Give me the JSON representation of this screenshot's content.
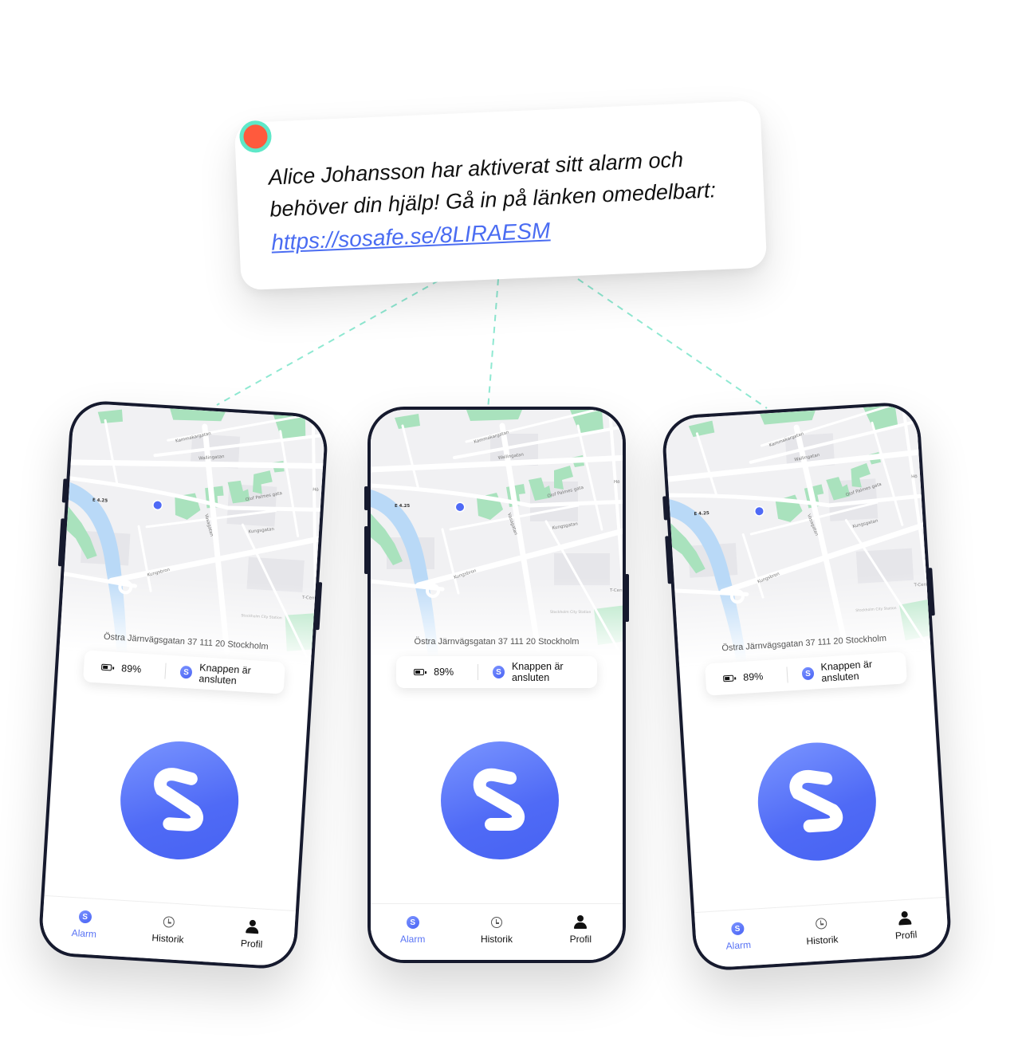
{
  "notification": {
    "line1": "Alice Johansson har aktiverat sitt alarm och",
    "line2": "behöver din hjälp! Gå in på länken omedelbart:",
    "link": "https://sosafe.se/8LIRAESM",
    "dot_color": "#ff5a3d",
    "ring_color": "#5ee8c8"
  },
  "phones": [
    {
      "address": "Östra Järnvägsgatan 37  111 20 Stockholm",
      "battery": "89%",
      "connection": "Knappen är ansluten",
      "tabs": [
        "Alarm",
        "Historik",
        "Profil"
      ],
      "map_labels": [
        "Kammakargatan",
        "Wallingatan",
        "Olof Palmes gata",
        "Kungsgatan",
        "Vasagatan",
        "Kungsbron",
        "E 4.25",
        "T-Centralen",
        "Stockholm City Station",
        "Hö"
      ]
    },
    {
      "address": "Östra Järnvägsgatan 37  111 20 Stockholm",
      "battery": "89%",
      "connection": "Knappen är ansluten",
      "tabs": [
        "Alarm",
        "Historik",
        "Profil"
      ],
      "map_labels": [
        "Kammakargatan",
        "Wallingatan",
        "Olof Palmes gata",
        "Kungsgatan",
        "Vasagatan",
        "Kungsbron",
        "E 4.25",
        "T-Centralen",
        "Stockholm City Station",
        "Hö"
      ]
    },
    {
      "address": "Östra Järnvägsgatan 37  111 20 Stockholm",
      "battery": "89%",
      "connection": "Knappen är ansluten",
      "tabs": [
        "Alarm",
        "Historik",
        "Profil"
      ],
      "map_labels": [
        "Kammakargatan",
        "Wallingatan",
        "Olof Palmes gata",
        "Kungsgatan",
        "Vasagatan",
        "Kungsbron",
        "E 4.25",
        "T-Centralen",
        "Stockholm City Station",
        "Hö"
      ]
    }
  ],
  "colors": {
    "accent": "#5a74f5",
    "frame": "#161a2e",
    "water": "#b9d9f7",
    "park": "#a9e2bd"
  },
  "icons": [
    "sosafe-logo-icon",
    "battery-icon",
    "clock-history-icon",
    "person-icon",
    "location-dot-icon"
  ]
}
